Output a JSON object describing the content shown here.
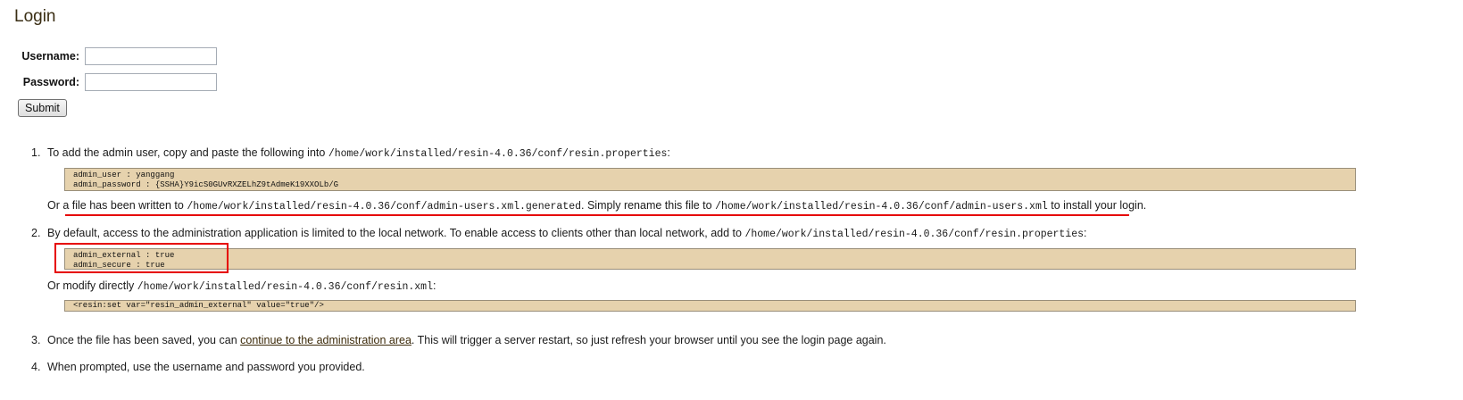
{
  "page": {
    "title": "Login"
  },
  "form": {
    "username_label": "Username:",
    "username_value": "",
    "password_label": "Password:",
    "password_value": "",
    "submit_label": "Submit"
  },
  "steps": {
    "step1": {
      "number": "1.",
      "text": "To add the admin user, copy and paste the following into",
      "path": "/home/work/installed/resin-4.0.36/conf/resin.properties",
      "suffix": ":",
      "code_lines": [
        "admin_user : yanggang",
        "admin_password : {SSHA}Y9icS0GUvRXZELhZ9tAdmeK19XXOLb/G"
      ],
      "or_prefix": "Or a file has been written to",
      "or_path1": "/home/work/installed/resin-4.0.36/conf/admin-users.xml.generated",
      "or_middle": ". Simply rename this file to",
      "or_path2": "/home/work/installed/resin-4.0.36/conf/admin-users.xml",
      "or_suffix": "to install your login."
    },
    "step2": {
      "number": "2.",
      "text": "By default, access to the administration application is limited to the local network. To enable access to clients other than local network, add to",
      "path": "/home/work/installed/resin-4.0.36/conf/resin.properties",
      "suffix": ":",
      "code_lines": [
        "admin_external : true",
        "admin_secure : true"
      ],
      "modify_prefix": "Or modify directly",
      "modify_path": "/home/work/installed/resin-4.0.36/conf/resin.xml",
      "modify_suffix": ":",
      "xml_code": "<resin:set var=\"resin_admin_external\" value=\"true\"/>"
    },
    "step3": {
      "number": "3.",
      "text_before": "Once the file has been saved, you can",
      "link": "continue to the administration area",
      "text_after": ". This will trigger a server restart, so just refresh your browser until you see the login page again."
    },
    "step4": {
      "number": "4.",
      "text": "When prompted, use the username and password you provided."
    }
  },
  "colors": {
    "code_background": "#e6d2ad",
    "annotation_red": "#e60000",
    "title_color": "#3a2e14"
  }
}
